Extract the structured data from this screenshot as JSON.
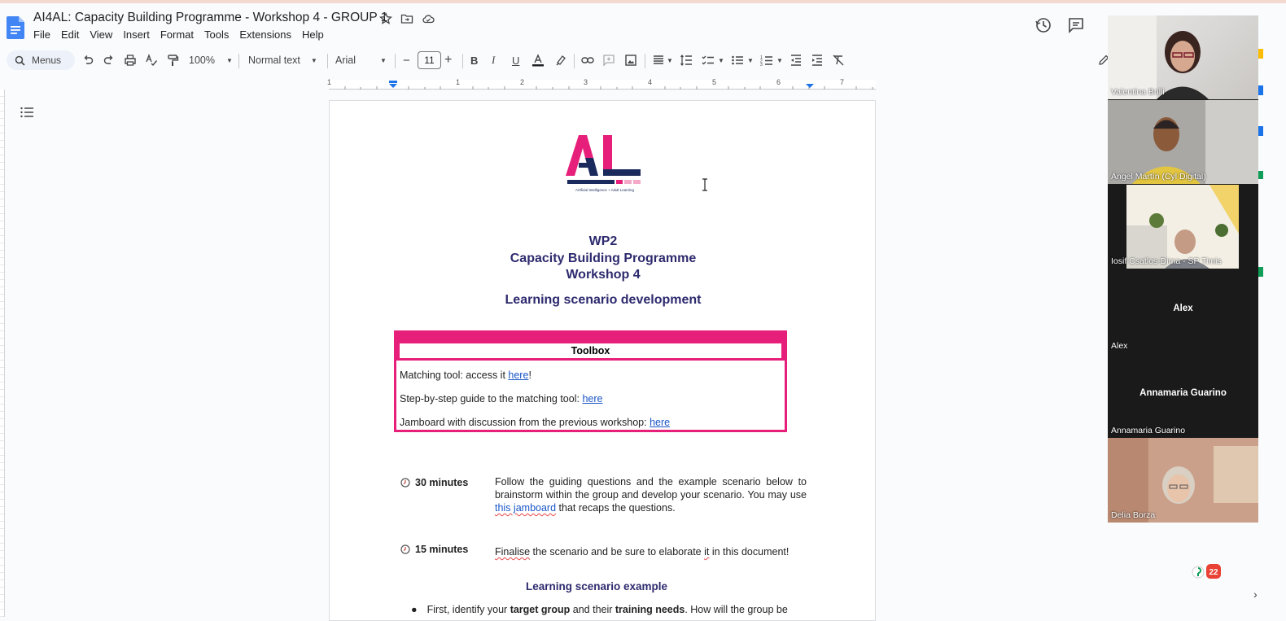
{
  "doc": {
    "title": "AI4AL: Capacity Building Programme - Workshop 4 - GROUP 1",
    "menu": [
      "File",
      "Edit",
      "View",
      "Insert",
      "Format",
      "Tools",
      "Extensions",
      "Help"
    ]
  },
  "toolbar": {
    "menus_label": "Menus",
    "zoom": "100%",
    "style": "Normal text",
    "font": "Arial",
    "font_size": "11",
    "minus": "−",
    "plus": "+"
  },
  "ruler": {
    "ticks": [
      "1",
      "1",
      "2",
      "3",
      "4",
      "5",
      "6",
      "7"
    ]
  },
  "page": {
    "logo": {
      "text": "AL",
      "tagline": "Artificial Intelligence + Adult Learning",
      "colors": {
        "navy": "#1b2a5c",
        "pink": "#e6207a",
        "light_pink": "#f4a9c8"
      }
    },
    "heading_wp": "WP2",
    "heading_programme": "Capacity Building Programme",
    "heading_workshop": "Workshop 4",
    "heading_scenario": "Learning scenario development",
    "toolbox": {
      "title": "Toolbox",
      "line1_text": "Matching tool: access it ",
      "line1_link": "here",
      "line1_after": "!",
      "line2_text": "Step-by-step guide to the matching tool: ",
      "line2_link": "here",
      "line3_text": "Jamboard with discussion from the previous workshop: ",
      "line3_link": "here"
    },
    "step1": {
      "duration": "30 minutes",
      "text_a": "Follow the guiding questions and the example scenario below to brainstorm within the group and develop your scenario. You may use ",
      "link": "this jamboard",
      "text_b": " that recaps the questions."
    },
    "step2": {
      "duration": "15 minutes",
      "word_finalise": "Finalise",
      "text_a": " the scenario and be sure to elaborate ",
      "word_it": "it",
      "text_b": " in this document!"
    },
    "example_heading": "Learning scenario example",
    "bullet1": {
      "a": "First, identify your ",
      "b": "target group",
      "c": " and their ",
      "d": "training needs",
      "e": ". How will the group be"
    }
  },
  "participants": [
    {
      "name": "Valentina Brilli",
      "video": true
    },
    {
      "name": "Ángel Martín (Cyl Digital)",
      "video": true
    },
    {
      "name": "Iosif Csatlos-Dima - SP Timis",
      "video": true
    },
    {
      "name": "Alex",
      "video": false,
      "center_label": "Alex"
    },
    {
      "name": "Annamaria Guarino",
      "video": false,
      "center_label": "Annamaria Guarino"
    },
    {
      "name": "Delia Borza",
      "video": true
    }
  ],
  "fab": {
    "badge": "22"
  }
}
